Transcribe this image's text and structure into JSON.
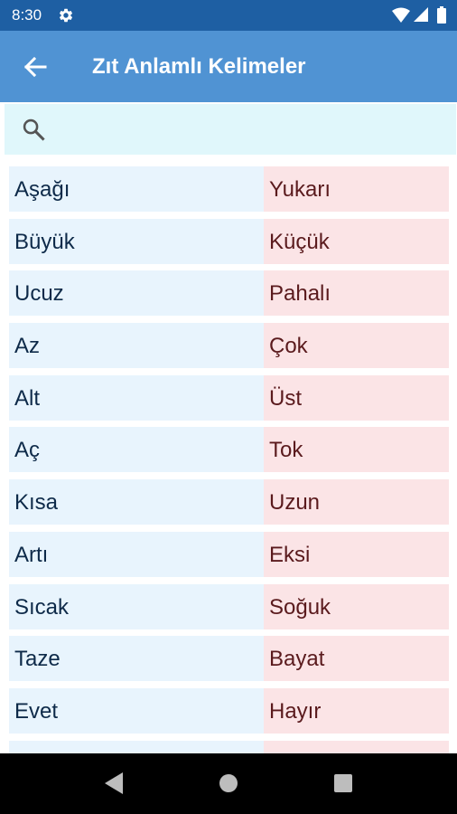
{
  "status_bar": {
    "time": "8:30"
  },
  "app_bar": {
    "title": "Zıt Anlamlı Kelimeler"
  },
  "search": {
    "placeholder": "",
    "value": ""
  },
  "word_pairs": [
    {
      "word": "Aşağı",
      "opposite": "Yukarı"
    },
    {
      "word": "Büyük",
      "opposite": "Küçük"
    },
    {
      "word": "Ucuz",
      "opposite": "Pahalı"
    },
    {
      "word": "Az",
      "opposite": "Çok"
    },
    {
      "word": "Alt",
      "opposite": "Üst"
    },
    {
      "word": "Aç",
      "opposite": "Tok"
    },
    {
      "word": "Kısa",
      "opposite": "Uzun"
    },
    {
      "word": "Artı",
      "opposite": "Eksi"
    },
    {
      "word": "Sıcak",
      "opposite": "Soğuk"
    },
    {
      "word": "Taze",
      "opposite": "Bayat"
    },
    {
      "word": "Evet",
      "opposite": "Hayır"
    },
    {
      "word": "",
      "opposite": ""
    }
  ],
  "colors": {
    "status_bar": "#1e5fa3",
    "app_bar": "#5093d3",
    "search_bg": "#e0f7fb",
    "word_bg": "#e8f4fd",
    "opposite_bg": "#fbe4e6",
    "word_text": "#0e2a49",
    "opposite_text": "#5a1a1d"
  },
  "icons": {
    "status": [
      "gear-icon",
      "wifi-icon",
      "signal-icon",
      "battery-icon"
    ],
    "app_bar": "arrow-back-icon",
    "search": "search-icon",
    "navigation": [
      "nav-back-icon",
      "nav-home-icon",
      "nav-recents-icon"
    ]
  }
}
